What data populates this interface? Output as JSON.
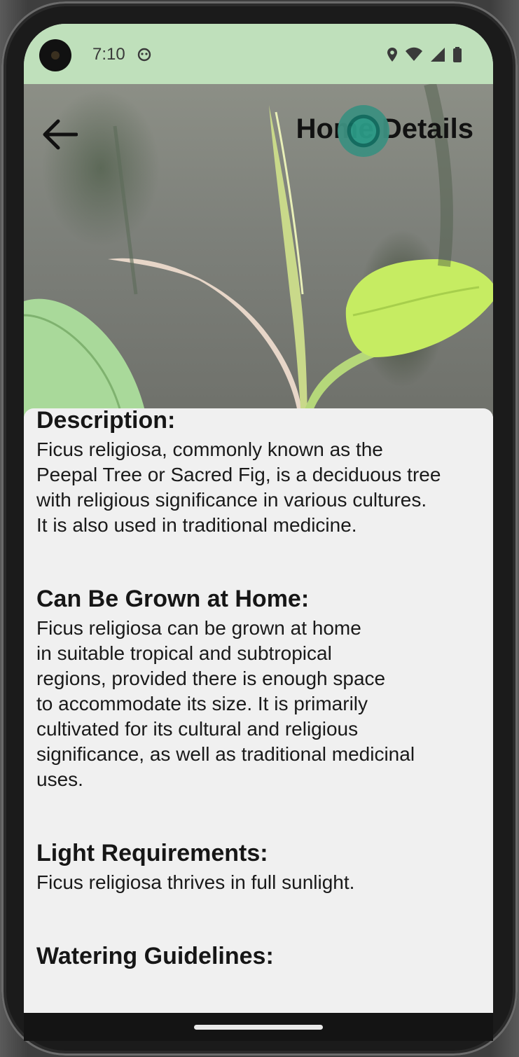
{
  "status_bar": {
    "time": "7:10",
    "icons": [
      "location-icon",
      "wifi-icon",
      "signal-icon",
      "battery-icon"
    ]
  },
  "header": {
    "title": "Home Details",
    "back_icon": "arrow-back-icon"
  },
  "sections": [
    {
      "heading": "Description:",
      "body": "Ficus religiosa, commonly known as the\nPeepal Tree or Sacred Fig, is a deciduous tree\nwith religious significance in various cultures.\nIt is also used in traditional medicine."
    },
    {
      "heading": "Can Be Grown at Home:",
      "body": "Ficus religiosa can be grown at home\nin suitable tropical and subtropical\nregions, provided there is enough space\nto accommodate its size. It is primarily\ncultivated for its cultural and religious\nsignificance, as well as traditional medicinal\nuses."
    },
    {
      "heading": "Light Requirements:",
      "body": "Ficus religiosa thrives in full sunlight."
    },
    {
      "heading": "Watering Guidelines:",
      "body": ""
    }
  ],
  "colors": {
    "status_bar_bg": "#bfe0bb",
    "sheet_bg": "#f0f0f0",
    "text": "#161616"
  }
}
